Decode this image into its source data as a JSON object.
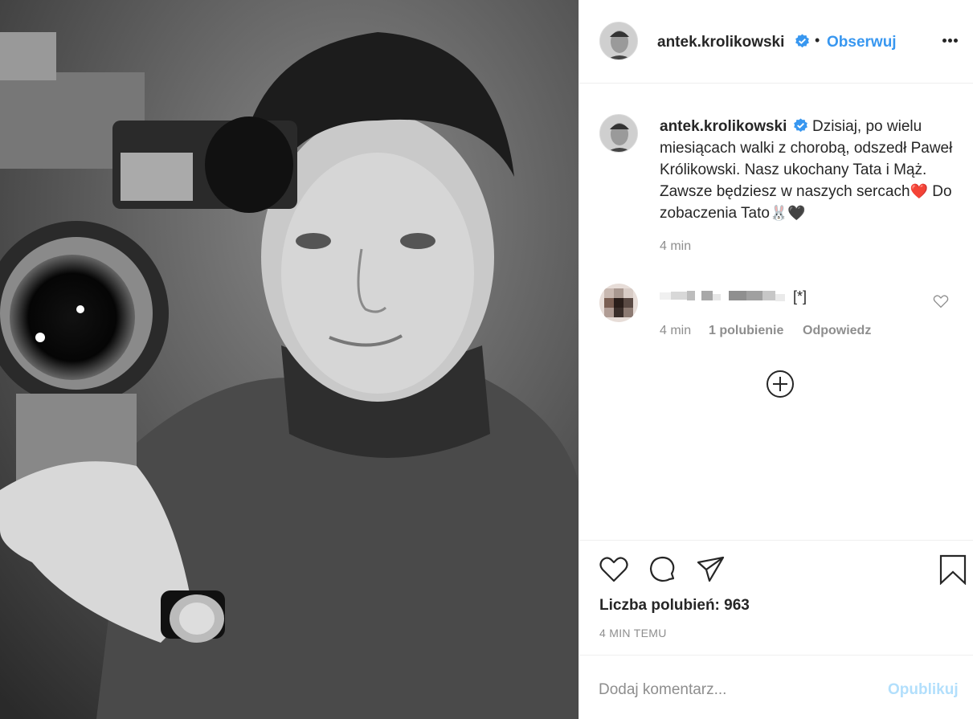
{
  "post": {
    "photo_alt": "black-and-white photo of a man with a film camera",
    "username": "antek.krolikowski",
    "verified": true,
    "dot": "•",
    "follow_label": "Obserwuj",
    "more_icon": "more-horizontal-icon"
  },
  "caption": {
    "username": "antek.krolikowski",
    "text_before_heart": "Dzisiaj, po wielu miesiącach walki z chorobą, odszedł Paweł Królikowski. Nasz ukochany Tata i Mąż. Zawsze będziesz w naszych sercach",
    "emoji_heart": "❤️",
    "text_after_heart": " Do zobaczenia Tato",
    "emoji_rabbit": "🐰",
    "emoji_black_heart": "🖤",
    "time": "4 min"
  },
  "comment": {
    "text": "[*]",
    "time": "4 min",
    "likes": "1 polubienie",
    "reply": "Odpowiedz"
  },
  "actions": {
    "likes_text": "Liczba polubień: 963",
    "posted": "4 MIN TEMU"
  },
  "add_comment": {
    "placeholder": "Dodaj komentarz...",
    "publish": "Opublikuj"
  },
  "colors": {
    "link_blue": "#3897f0",
    "verified_blue": "#3897f0",
    "muted": "#8e8e8e",
    "publish_disabled": "#b2dffc"
  }
}
